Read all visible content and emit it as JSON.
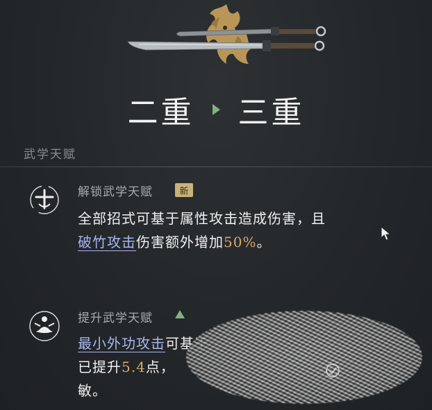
{
  "header": {
    "tier_from": "二重",
    "tier_to": "三重",
    "weapon_icon": "twin-sabres-icon",
    "emblem_icon": "golden-beast-emblem"
  },
  "section": {
    "title": "武学天赋"
  },
  "talents": [
    {
      "name": "解锁武学天赋",
      "badge": "新",
      "icon": "unlock-talent-icon",
      "desc_prefix": "全部招式可基于属性攻击造成伤害，且",
      "desc_skill": "破竹攻击",
      "desc_middle": "伤害额外增加",
      "desc_value": "50%",
      "desc_suffix": "。"
    },
    {
      "name": "提升武学天赋",
      "indicator": "upgrade-arrow-icon",
      "icon": "meditation-talent-icon",
      "desc_skill": "最小外功攻击",
      "desc_after_skill": "可基于",
      "desc_line2_prefix": "已提升",
      "desc_value": "5.4",
      "desc_line2_suffix": "点，",
      "desc_line3": "敏。"
    }
  ],
  "colors": {
    "skill_link": "#a9b5f0",
    "value_highlight": "#d9a96a",
    "badge_bg": "#c9b27a",
    "arrow_green": "#7fb37f"
  }
}
